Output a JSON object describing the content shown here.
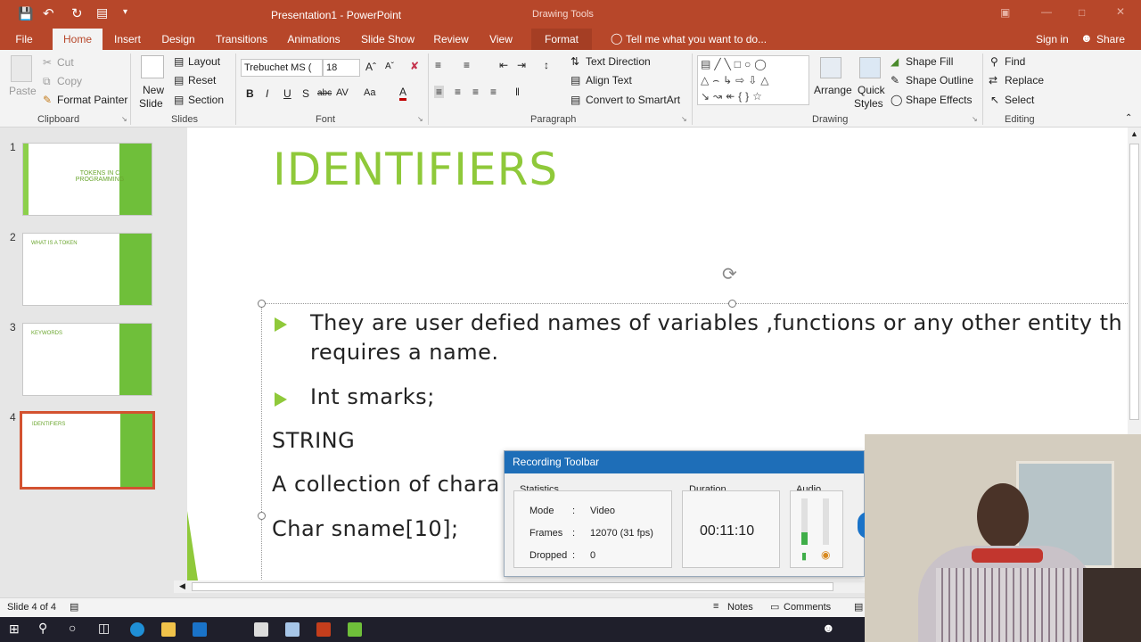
{
  "window": {
    "title": "Presentation1 - PowerPoint",
    "context_tab_group": "Drawing Tools"
  },
  "tabs": [
    "File",
    "Home",
    "Insert",
    "Design",
    "Transitions",
    "Animations",
    "Slide Show",
    "Review",
    "View",
    "Format"
  ],
  "tell_me": "Tell me what you want to do...",
  "account": {
    "sign_in": "Sign in",
    "share": "Share"
  },
  "ribbon": {
    "clipboard": {
      "paste": "Paste",
      "cut": "Cut",
      "copy": "Copy",
      "format_painter": "Format Painter",
      "label": "Clipboard"
    },
    "slides": {
      "new_slide": "New",
      "new_slide2": "Slide",
      "layout": "Layout",
      "reset": "Reset",
      "section": "Section",
      "label": "Slides"
    },
    "font": {
      "family": "Trebuchet MS (",
      "size": "18",
      "bold": "B",
      "italic": "I",
      "underline": "U",
      "shadow": "S",
      "strike": "abc",
      "spacing": "AV",
      "case": "Aa",
      "label": "Font"
    },
    "paragraph": {
      "text_direction": "Text Direction",
      "align_text": "Align Text",
      "convert": "Convert to SmartArt",
      "label": "Paragraph"
    },
    "drawing": {
      "arrange": "Arrange",
      "quick": "Quick",
      "styles": "Styles",
      "shape_fill": "Shape Fill",
      "shape_outline": "Shape Outline",
      "shape_effects": "Shape Effects",
      "label": "Drawing"
    },
    "editing": {
      "find": "Find",
      "replace": "Replace",
      "select": "Select",
      "label": "Editing"
    }
  },
  "thumbnails": [
    {
      "num": "1",
      "title": "TOKENS IN C PROGRAMMING"
    },
    {
      "num": "2",
      "title": "WHAT IS A TOKEN"
    },
    {
      "num": "3",
      "title": "KEYWORDS"
    },
    {
      "num": "4",
      "title": "IDENTIFIERS"
    }
  ],
  "slide": {
    "title": "IDENTIFIERS",
    "bullet1_line1": "They are user defied names of variables ,functions or any other entity th",
    "bullet1_line2": "requires a name.",
    "bullet2": "Int smarks;",
    "line3": "STRING",
    "line4": "A collection of chara",
    "line5": "Char sname[10];"
  },
  "status": {
    "slide": "Slide 4 of 4",
    "notes": "Notes",
    "comments": "Comments"
  },
  "recording": {
    "title": "Recording Toolbar",
    "stats_label": "Statistics",
    "mode_label": "Mode",
    "mode_value": "Video",
    "frames_label": "Frames",
    "frames_value": "12070 (31 fps)",
    "dropped_label": "Dropped",
    "dropped_value": "0",
    "colon": ":",
    "duration_label": "Duration",
    "duration_value": "00:11:10",
    "audio_label": "Audio"
  }
}
